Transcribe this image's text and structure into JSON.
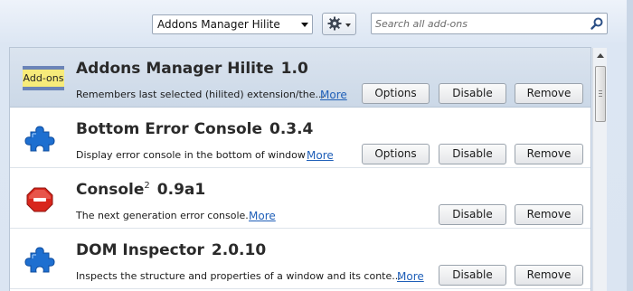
{
  "toolbar": {
    "view_select": "Addons Manager Hilite",
    "gear_icon": "gear-icon",
    "search_placeholder": "Search all add-ons",
    "search_icon": "search-icon"
  },
  "addons": [
    {
      "name": "Addons Manager Hilite",
      "version": "1.0",
      "superscript": "",
      "description": "Remembers last selected (hilited) extension/the...",
      "more": "More",
      "icon": "addons-badge-icon",
      "icon_text": "Add-ons",
      "selected": true,
      "options": "Options",
      "disable": "Disable",
      "remove": "Remove"
    },
    {
      "name": "Bottom Error Console",
      "version": "0.3.4",
      "superscript": "",
      "description": "Display error console in the bottom of window",
      "more": "More",
      "icon": "puzzle-piece-icon",
      "selected": false,
      "options": "Options",
      "disable": "Disable",
      "remove": "Remove"
    },
    {
      "name": "Console",
      "version": "0.9a1",
      "superscript": "2",
      "description": "The next generation error console.",
      "more": "More",
      "icon": "red-stop-icon",
      "selected": false,
      "disable": "Disable",
      "remove": "Remove"
    },
    {
      "name": "DOM Inspector",
      "version": "2.0.10",
      "superscript": "",
      "description": "Inspects the structure and properties of a window and its conte...",
      "more": "More",
      "icon": "puzzle-piece-icon",
      "selected": false,
      "disable": "Disable",
      "remove": "Remove"
    }
  ],
  "colors": {
    "accent": "#1f5fb8",
    "selected_row": "#d3deeb",
    "puzzle_blue": "#1e6fd0",
    "stop_red": "#d8261c"
  }
}
